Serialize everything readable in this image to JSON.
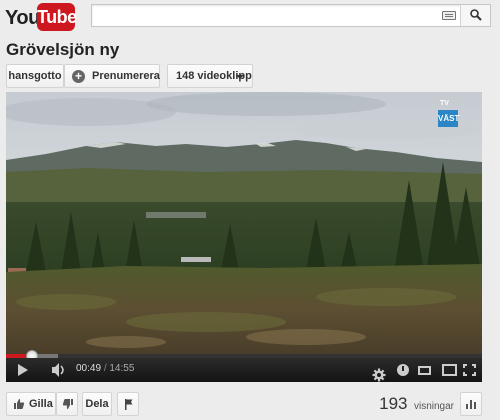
{
  "header": {
    "logo": {
      "you": "You",
      "tube": "Tube"
    },
    "search": {
      "value": "",
      "placeholder": ""
    }
  },
  "video": {
    "title": "Grövelsjön ny",
    "channel": "hansgotto",
    "subscribe_label": "Prenumerera",
    "videos_label": "148 videoklipp"
  },
  "player": {
    "badge_top": "TV",
    "badge_bottom": "VÄST",
    "current_time": "00:49",
    "separator": "/",
    "duration": "14:55",
    "played_fraction": 0.055,
    "buffered_fraction": 0.11
  },
  "actions": {
    "like_label": "Gilla",
    "share_label": "Dela"
  },
  "stats": {
    "view_count": "193",
    "views_label": "visningar"
  },
  "colors": {
    "brand_red": "#cc181e",
    "badge_blue": "#2c86c5"
  }
}
